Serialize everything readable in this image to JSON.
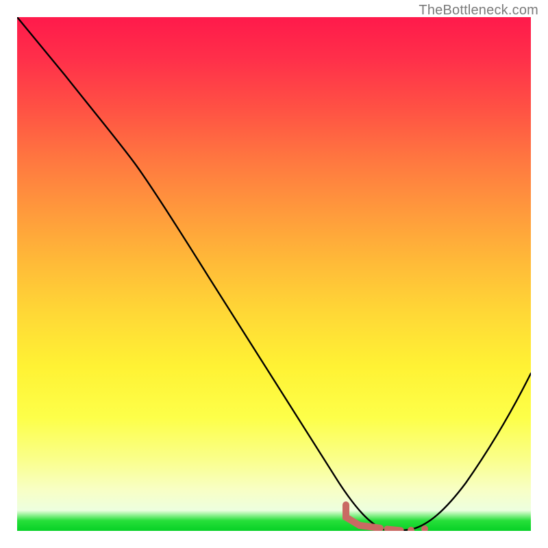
{
  "watermark": "TheBottleneck.com",
  "chart_data": {
    "type": "line",
    "title": "",
    "xlabel": "",
    "ylabel": "",
    "xlim": [
      0,
      100
    ],
    "ylim": [
      0,
      100
    ],
    "series": [
      {
        "name": "curve",
        "x": [
          0,
          10,
          20,
          30,
          40,
          50,
          60,
          65,
          70,
          74,
          78,
          82,
          86,
          90,
          95,
          100
        ],
        "y": [
          100,
          88,
          76,
          63,
          48,
          33,
          18,
          10,
          3,
          0,
          0,
          3,
          10,
          18,
          30,
          42
        ]
      }
    ],
    "trough_markers": {
      "x_range": [
        64,
        78
      ],
      "color": "#c96a63"
    },
    "background": "red-to-yellow-to-green vertical gradient"
  }
}
